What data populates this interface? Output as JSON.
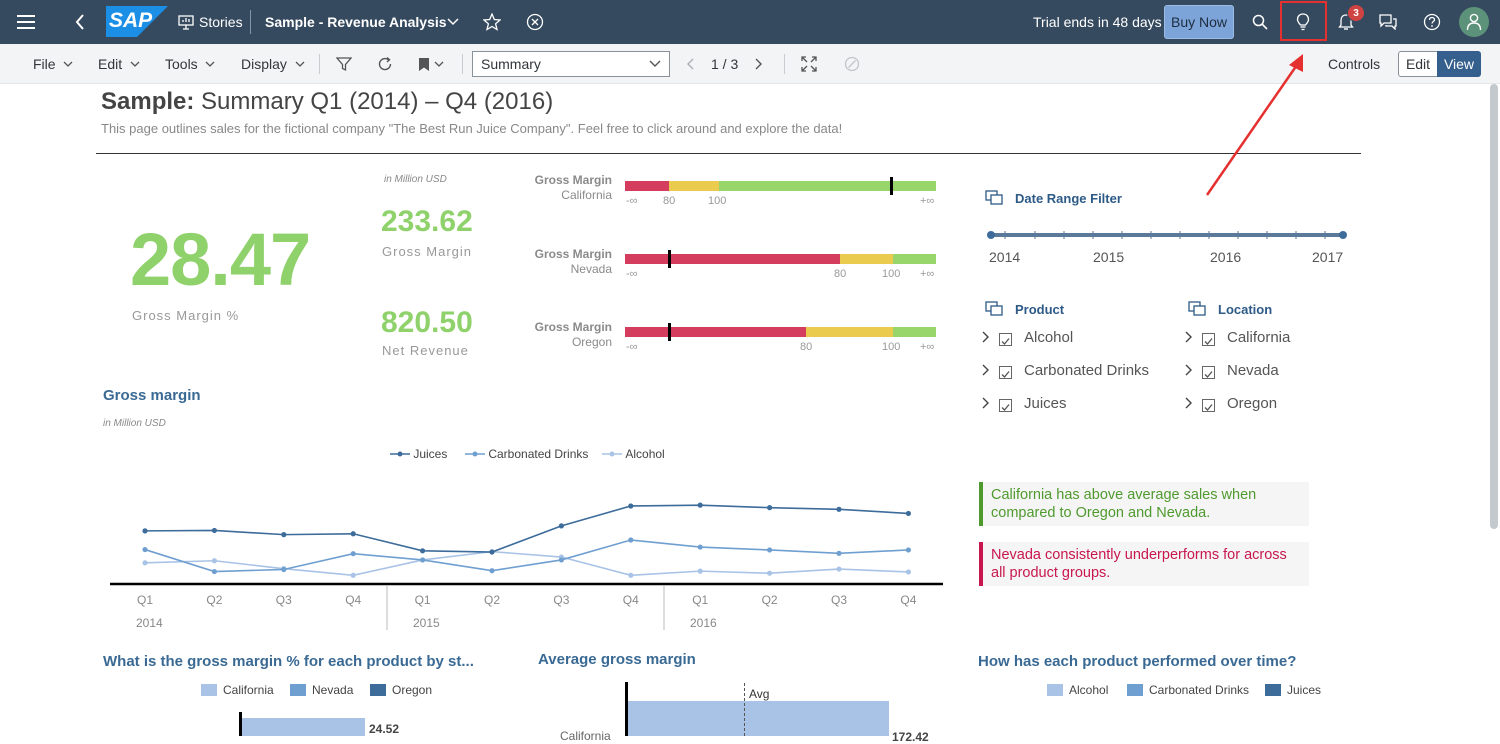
{
  "shell": {
    "logo": "SAP",
    "stories_label": "Stories",
    "story_title": "Sample - Revenue Analysis",
    "trial_text": "Trial ends in 48 days",
    "buy_now": "Buy Now",
    "notification_count": "3"
  },
  "toolbar": {
    "menus": [
      "File",
      "Edit",
      "Tools",
      "Display"
    ],
    "page_select": "Summary",
    "pager": "1 / 3",
    "controls": "Controls",
    "edit": "Edit",
    "view": "View"
  },
  "page": {
    "title_bold": "Sample:",
    "title_rest": " Summary Q1 (2014) – Q4 (2016)",
    "subtitle": "This page outlines sales for the fictional company \"The Best Run Juice Company\". Feel free to click around and explore the data!"
  },
  "kpis": {
    "gross_margin_pct_value": "28.47",
    "gross_margin_pct_label": "Gross Margin %",
    "unit_note": "in Million USD",
    "gross_margin_value": "233.62",
    "gross_margin_label": "Gross Margin",
    "net_revenue_value": "820.50",
    "net_revenue_label": "Net Revenue"
  },
  "bullets": [
    {
      "title": "Gross Margin",
      "region": "California",
      "ticks": [
        "-∞",
        "80",
        "100",
        "+∞"
      ]
    },
    {
      "title": "Gross Margin",
      "region": "Nevada",
      "ticks": [
        "-∞",
        "80",
        "100",
        "+∞"
      ]
    },
    {
      "title": "Gross Margin",
      "region": "Oregon",
      "ticks": [
        "-∞",
        "80",
        "100",
        "+∞"
      ]
    }
  ],
  "colors": {
    "shell": "#354a5f",
    "kpi_green": "#8fd16a",
    "bad": "#d43d5e",
    "mid": "#eacb4e",
    "good": "#98d56a",
    "juices": "#3d6c9b",
    "carbonated": "#6f9fd0",
    "alcohol": "#a8c3e6",
    "insight_green": "#4f9a2e",
    "insight_red": "#c8174f"
  },
  "filters": {
    "date_title": "Date Range Filter",
    "years": [
      "2014",
      "2015",
      "2016",
      "2017"
    ],
    "product_title": "Product",
    "products": [
      "Alcohol",
      "Carbonated Drinks",
      "Juices"
    ],
    "location_title": "Location",
    "locations": [
      "California",
      "Nevada",
      "Oregon"
    ]
  },
  "insights": [
    {
      "text": "California has above average sales when compared to Oregon and Nevada."
    },
    {
      "text": "Nevada consistently underperforms for across all product groups."
    }
  ],
  "gross_margin_chart": {
    "title": "Gross margin",
    "note": "in Million USD",
    "legend": [
      "Juices",
      "Carbonated Drinks",
      "Alcohol"
    ],
    "quarters": [
      "Q1",
      "Q2",
      "Q3",
      "Q4",
      "Q1",
      "Q2",
      "Q3",
      "Q4",
      "Q1",
      "Q2",
      "Q3",
      "Q4"
    ],
    "years": [
      "2014",
      "2015",
      "2016"
    ]
  },
  "chart_data": [
    {
      "type": "line",
      "title": "Gross margin",
      "x": [
        "Q1 2014",
        "Q2 2014",
        "Q3 2014",
        "Q4 2014",
        "Q1 2015",
        "Q2 2015",
        "Q3 2015",
        "Q4 2015",
        "Q1 2016",
        "Q2 2016",
        "Q3 2016",
        "Q4 2016"
      ],
      "series": [
        {
          "name": "Juices",
          "values": [
            64,
            64.5,
            59.5,
            60.5,
            40,
            38.5,
            70,
            94,
            95,
            92,
            90,
            85
          ]
        },
        {
          "name": "Carbonated Drinks",
          "values": [
            41.5,
            15,
            17.5,
            36.5,
            29,
            16,
            29,
            53,
            44.5,
            41,
            37,
            41
          ]
        },
        {
          "name": "Alcohol",
          "values": [
            25.5,
            28,
            18.5,
            10.5,
            29,
            39,
            32.5,
            10.5,
            15.5,
            13,
            18,
            14.5
          ]
        }
      ],
      "grid": false,
      "legend": "top"
    },
    {
      "type": "bar",
      "title": "What is the gross margin % for each product by st...",
      "series": [
        {
          "name": "California",
          "values": [
            24.52
          ]
        },
        {
          "name": "Nevada",
          "values": []
        },
        {
          "name": "Oregon",
          "values": []
        }
      ],
      "legend": "top"
    },
    {
      "type": "bar",
      "title": "Average gross margin",
      "reference_line": "Avg",
      "values": [
        172.42
      ]
    },
    {
      "type": "bar",
      "title": "How has each product performed over time?",
      "series": [
        {
          "name": "Alcohol",
          "values": []
        },
        {
          "name": "Carbonated Drinks",
          "values": []
        },
        {
          "name": "Juices",
          "values": []
        }
      ],
      "legend": "top"
    }
  ],
  "bottom": {
    "chart1_title": "What is the gross margin % for each product by st...",
    "chart1_legend": [
      "California",
      "Nevada",
      "Oregon"
    ],
    "chart1_value": "24.52",
    "chart2_title": "Average gross margin",
    "chart2_avg": "Avg",
    "chart2_category": "California",
    "chart2_value": "172.42",
    "chart3_title": "How has each product performed over time?",
    "chart3_legend": [
      "Alcohol",
      "Carbonated Drinks",
      "Juices"
    ]
  }
}
